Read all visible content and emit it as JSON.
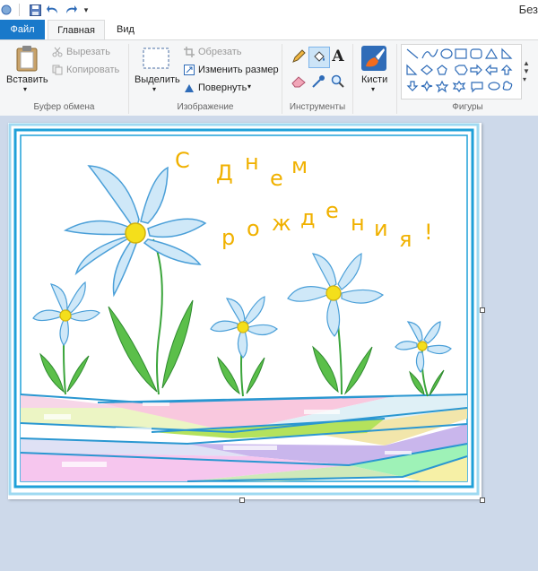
{
  "window": {
    "title": "Без"
  },
  "tabs": {
    "file": "Файл",
    "home": "Главная",
    "view": "Вид"
  },
  "clipboard": {
    "paste": "Вставить",
    "cut": "Вырезать",
    "copy": "Копировать",
    "label": "Буфер обмена"
  },
  "image": {
    "select": "Выделить",
    "crop": "Обрезать",
    "resize": "Изменить размер",
    "rotate": "Повернуть",
    "label": "Изображение"
  },
  "tools": {
    "label": "Инструменты",
    "text_tool": "A"
  },
  "brushes": {
    "label": "Кисти"
  },
  "shapes": {
    "label": "Фигуры"
  },
  "card": {
    "line1": [
      "С",
      "Д",
      "н",
      "е",
      "м"
    ],
    "line2": [
      "р",
      "о",
      "ж",
      "д",
      "е",
      "н",
      "и",
      "я",
      "!"
    ]
  },
  "colors": {
    "accent": "#1979ca",
    "frame": "#1fa0d8",
    "letters": "#f0b100",
    "petals": "#cfe8f8",
    "stems": "#3ba53b",
    "center": "#f4df1b"
  }
}
